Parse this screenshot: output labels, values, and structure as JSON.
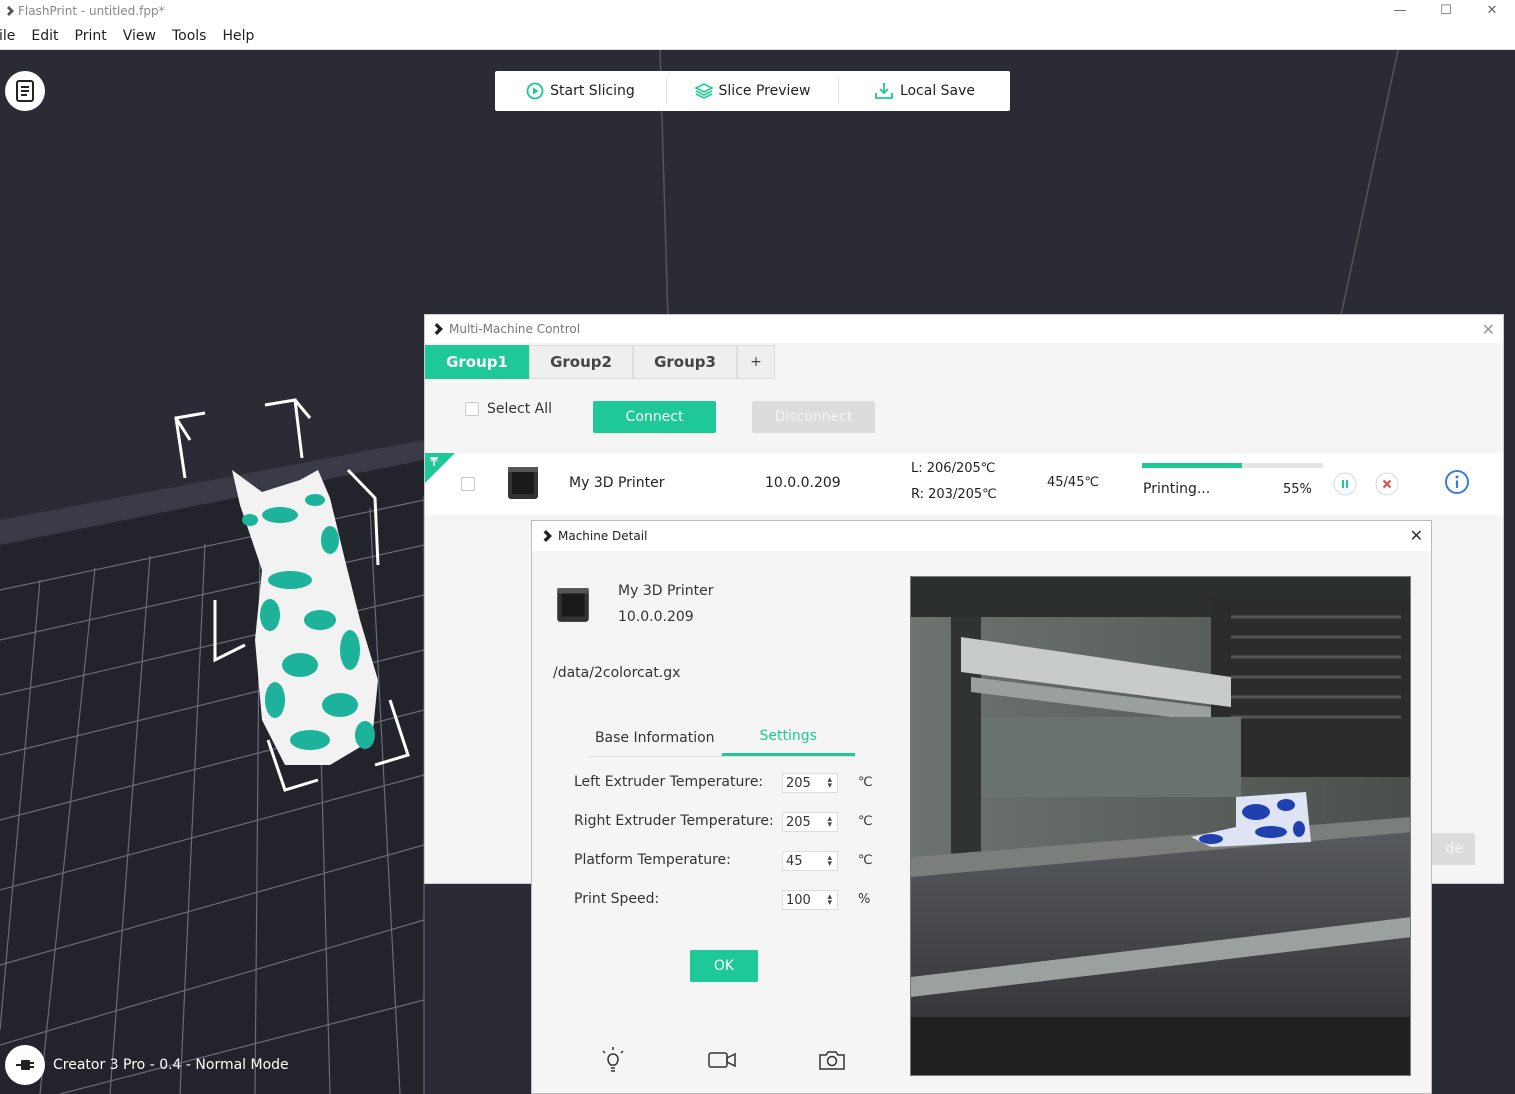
{
  "window": {
    "title": "FlashPrint - untitled.fpp*",
    "controls": {
      "minimize": "—",
      "maximize": "☐",
      "close": "✕"
    }
  },
  "menu": [
    "ile",
    "Edit",
    "Print",
    "View",
    "Tools",
    "Help"
  ],
  "toolbar": {
    "start_slicing": "Start Slicing",
    "slice_preview": "Slice Preview",
    "local_save": "Local Save"
  },
  "status": {
    "mode": "Creator 3 Pro - 0.4 - Normal Mode"
  },
  "multi_machine": {
    "title": "Multi-Machine Control",
    "close": "✕",
    "tabs": [
      "Group1",
      "Group2",
      "Group3"
    ],
    "add_tab": "+",
    "select_all": "Select All",
    "connect": "Connect",
    "disconnect": "Disconnect",
    "bottom_button": "de",
    "machine": {
      "name": "My 3D Printer",
      "ip": "10.0.0.209",
      "left_temp": "L: 206/205℃",
      "right_temp": "R: 203/205℃",
      "platform_temp": "45/45℃",
      "state": "Printing...",
      "progress_pct": "55%",
      "progress": 0.55
    }
  },
  "machine_detail": {
    "title": "Machine Detail",
    "close": "✕",
    "name": "My 3D Printer",
    "ip": "10.0.0.209",
    "file": "/data/2colorcat.gx",
    "tabs": {
      "base": "Base Information",
      "settings": "Settings"
    },
    "settings": [
      {
        "label": "Left Extruder Temperature:",
        "value": "205",
        "unit": "℃"
      },
      {
        "label": "Right Extruder Temperature:",
        "value": "205",
        "unit": "℃"
      },
      {
        "label": "Platform Temperature:",
        "value": "45",
        "unit": "℃"
      },
      {
        "label": "Print Speed:",
        "value": "100",
        "unit": "%"
      }
    ],
    "ok": "OK"
  },
  "colors": {
    "accent": "#1ec997",
    "viewport": "#2b2b36",
    "info_blue": "#3a7bd5",
    "cancel_red": "#e04848"
  }
}
